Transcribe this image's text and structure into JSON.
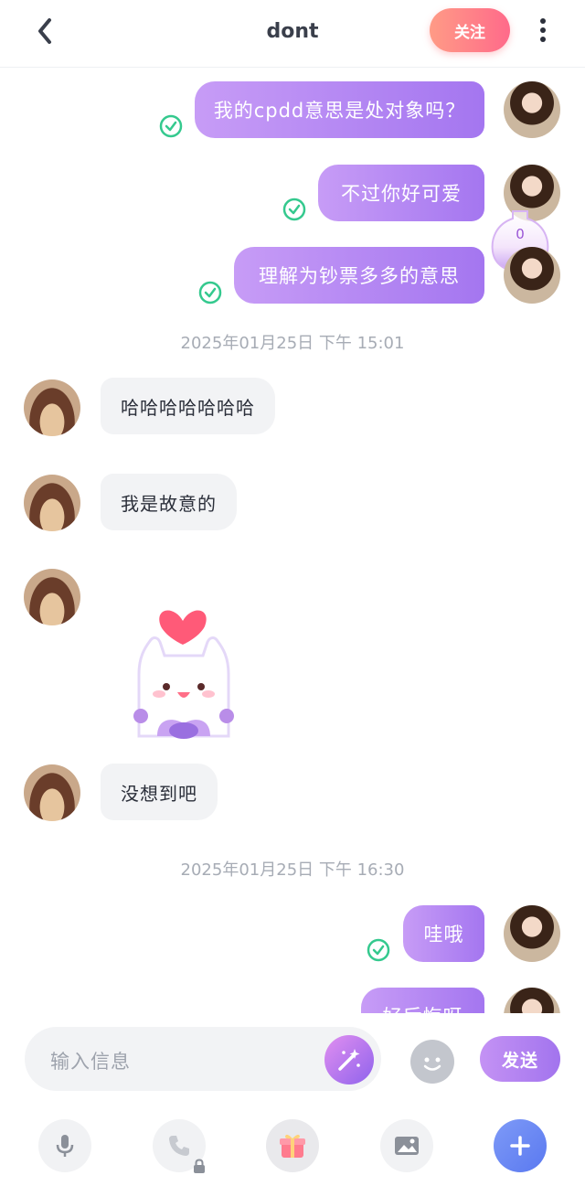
{
  "header": {
    "title": "dont",
    "follow_label": "关注"
  },
  "counter": {
    "value": "0"
  },
  "messages": [
    {
      "side": "out",
      "text": "我的cpdd意思是处对象吗？"
    },
    {
      "side": "out",
      "text": "不过你好可爱"
    },
    {
      "side": "out",
      "text": "理解为钞票多多的意思"
    },
    {
      "side": "time",
      "text": "2025年01月25日 下午 15:01"
    },
    {
      "side": "in",
      "text": "哈哈哈哈哈哈哈"
    },
    {
      "side": "in",
      "text": "我是故意的"
    },
    {
      "side": "in",
      "type": "sticker",
      "sticker": "heart-bunny-sticker"
    },
    {
      "side": "in",
      "text": "没想到吧"
    },
    {
      "side": "time",
      "text": "2025年01月25日 下午 16:30"
    },
    {
      "side": "out",
      "text": "哇哦"
    },
    {
      "side": "out",
      "text": "好后悔呀"
    }
  ],
  "composer": {
    "placeholder": "输入信息",
    "send_label": "发送"
  },
  "toolbar": [
    "microphone-icon",
    "phone-icon",
    "gift-icon",
    "image-icon",
    "plus-icon"
  ],
  "colors": {
    "bubble_out": "#a476f0",
    "bubble_in": "#f2f3f5",
    "follow": "#ff6a8a",
    "read_check": "#34c98e",
    "plus_button": "#5a79f0"
  }
}
